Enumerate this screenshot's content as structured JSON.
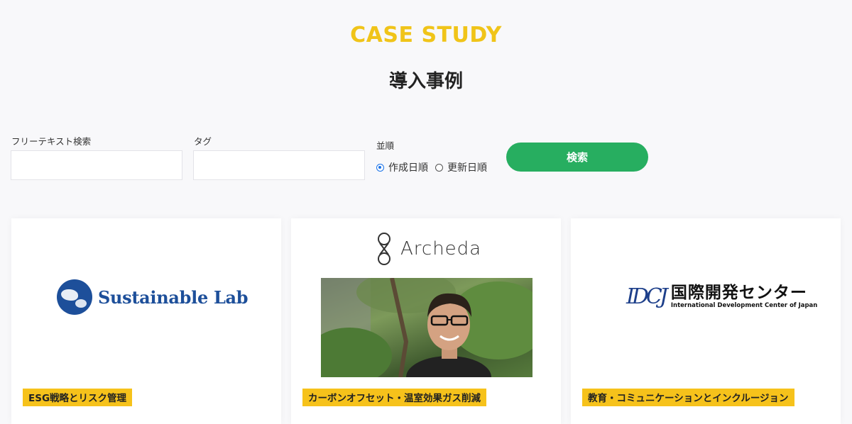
{
  "header": {
    "eyebrow": "CASE STUDY",
    "title": "導入事例"
  },
  "filters": {
    "freetext_label": "フリーテキスト検索",
    "freetext_value": "",
    "tag_label": "タグ",
    "tag_value": "",
    "sort_label": "並順",
    "sort_options": [
      {
        "label": "作成日順",
        "selected": true
      },
      {
        "label": "更新日順",
        "selected": false
      }
    ],
    "search_button": "検索"
  },
  "cards": [
    {
      "logo_text": "Sustainable Lab",
      "logo_icon": "globe-logo-icon",
      "tag": "ESG戦略とリスク管理"
    },
    {
      "logo_text": "Archeda",
      "logo_icon": "archeda-mark-icon",
      "photo": "portrait-photo",
      "tag": "カーボンオフセット・温室効果ガス削減"
    },
    {
      "logo_mark": "IDCJ",
      "logo_text_ja": "国際開発センター",
      "logo_text_en": "International Development Center of Japan",
      "tag": "教育・コミュニケーションとインクルージョン"
    }
  ],
  "colors": {
    "accent_yellow": "#f0c419",
    "tag_yellow": "#f6c21b",
    "button_green": "#27ae60",
    "brand_blue": "#1d4f9a"
  }
}
